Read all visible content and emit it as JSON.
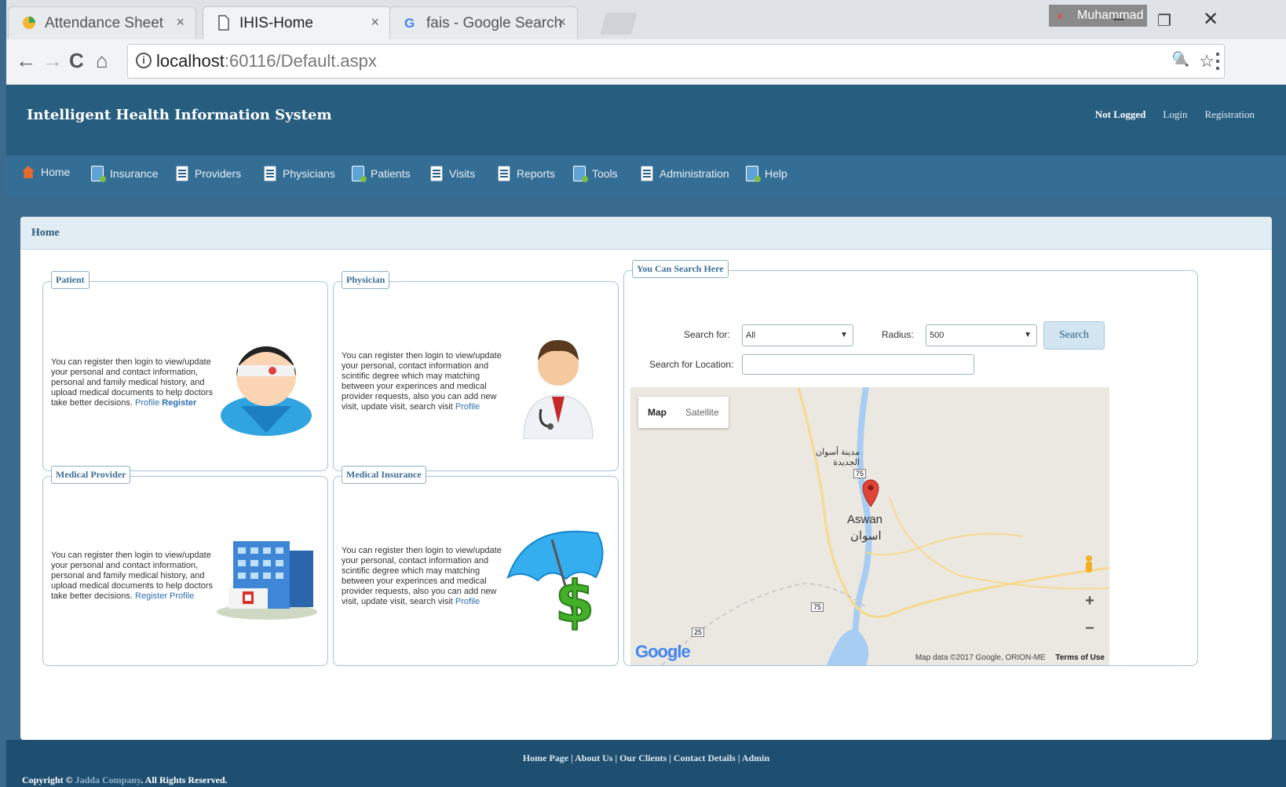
{
  "browser": {
    "tabs": [
      {
        "title": "Attendance Sheet",
        "close": "×"
      },
      {
        "title": "IHIS-Home",
        "close": "×"
      },
      {
        "title": "fais - Google Search",
        "close": "×"
      }
    ],
    "profile_name": "Muhammad",
    "window_controls": {
      "minimize": "–",
      "restore": "❐",
      "close": "✕"
    },
    "url_host": "localhost",
    "url_path": ":60116/Default.aspx",
    "nav": {
      "back": "←",
      "forward": "→",
      "reload": "C",
      "home": "⌂"
    },
    "omni_icons": {
      "info": "i",
      "zoom": "🔍",
      "star": "☆",
      "ext": "⛰",
      "menu": "⋮"
    }
  },
  "site": {
    "title": "Intelligent Health Information System",
    "status": "Not Logged",
    "login": "Login",
    "registration": "Registration"
  },
  "menu": [
    {
      "label": "Home",
      "icon": "home-icon"
    },
    {
      "label": "Insurance",
      "icon": "chart-icon"
    },
    {
      "label": "Providers",
      "icon": "doc-icon"
    },
    {
      "label": "Physicians",
      "icon": "doc-icon"
    },
    {
      "label": "Patients",
      "icon": "chart-icon"
    },
    {
      "label": "Visits",
      "icon": "doc-icon"
    },
    {
      "label": "Reports",
      "icon": "doc-icon"
    },
    {
      "label": "Tools",
      "icon": "chart-icon"
    },
    {
      "label": "Administration",
      "icon": "doc-icon"
    },
    {
      "label": "Help",
      "icon": "chart-icon"
    }
  ],
  "page_heading": "Home",
  "cards": {
    "patient": {
      "legend": "Patient",
      "text": "You can register then login to view/update your personal and contact information, personal and family medical history, and upload medical documents to help doctors take better decisions.",
      "link1": "Profile",
      "link2": "Register"
    },
    "physician": {
      "legend": "Physician",
      "text": "You can register then login to view/update your personal, contact information and scintific degree which may matching between your experinces and medical provider requests, also you can add new visit, update visit, search visit",
      "link1": "Profile"
    },
    "provider": {
      "legend": "Medical Provider",
      "text": "You can register then login to view/update your personal and contact information, personal and family medical history, and upload medical documents to help doctors take better decisions.",
      "link1": "Register",
      "link2": "Profile"
    },
    "insurance": {
      "legend": "Medical Insurance",
      "text": "You can register then login to view/update your personal, contact information and scintific degree which may matching between your experinces and medical provider requests, also you can add new visit, update visit, search visit",
      "link1": "Profile"
    }
  },
  "search": {
    "legend": "You Can Search Here",
    "search_for_label": "Search for:",
    "search_for_value": "All",
    "radius_label": "Radius:",
    "radius_value": "500",
    "location_label": "Search for Location:",
    "button": "Search"
  },
  "map": {
    "type_map": "Map",
    "type_satellite": "Satellite",
    "city_en": "Aswan",
    "city_ar": "اسوان",
    "new_city_ar_1": "مدينة أسوان",
    "new_city_ar_2": "الجديدة",
    "road_75a": "75",
    "road_75b": "75",
    "road_25": "25",
    "zoom_in": "+",
    "zoom_out": "–",
    "google": "Google",
    "data_text": "Map data ©2017 Google, ORION-ME",
    "terms": "Terms of Use",
    "colors": {
      "water": "#a7cdf2",
      "road": "#f5d98e",
      "land": "#ebe8e1"
    }
  },
  "footer": {
    "links": "Home Page | About Us | Our Clients | Contact Details | Admin",
    "copyright_prefix": "Copyright © ",
    "company": "Jadda Company",
    "copyright_suffix": ". All Rights Reserved."
  }
}
